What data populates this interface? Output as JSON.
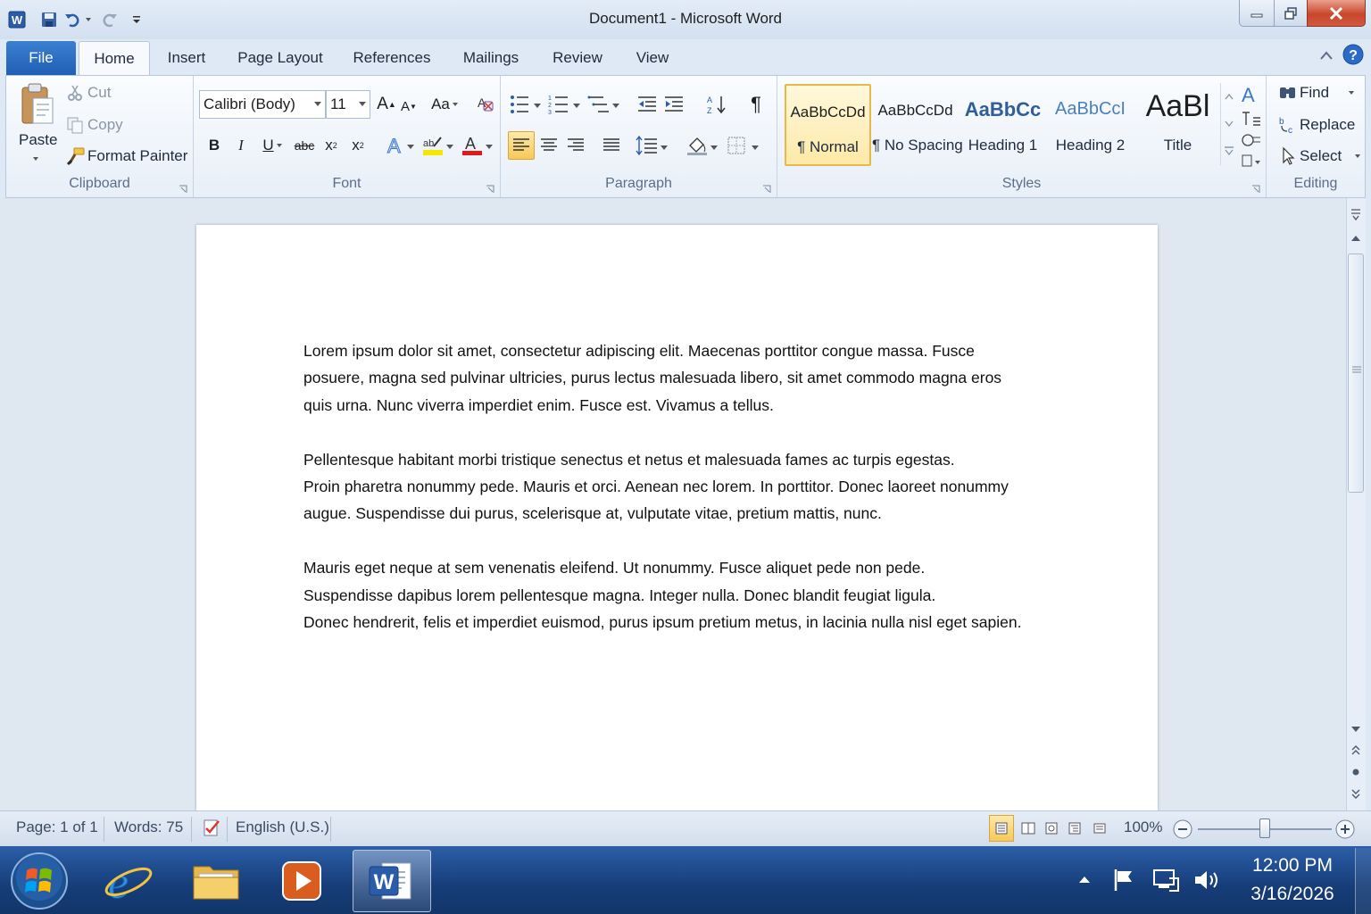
{
  "window": {
    "title": "Document1  -  Microsoft Word",
    "colors": {
      "accent": "#1f5fb4",
      "close": "#c9462c",
      "selected_style": "#fde9a8"
    }
  },
  "tabs": {
    "file": "File",
    "items": [
      "Home",
      "Insert",
      "Page Layout",
      "References",
      "Mailings",
      "Review",
      "View"
    ]
  },
  "ribbon": {
    "clipboard": {
      "label": "Clipboard",
      "paste": "Paste",
      "cut": "Cut",
      "copy": "Copy",
      "format_painter": "Format Painter"
    },
    "font": {
      "label": "Font",
      "font_name": "Calibri (Body)",
      "font_size": "11",
      "grow_glyph": "A",
      "change_case_glyph": "Aa",
      "bold_glyph": "B",
      "italic_glyph": "I",
      "underline_glyph": "U",
      "strike_glyph": "abc",
      "subscript_glyph": "x",
      "superscript_glyph": "x"
    },
    "paragraph": {
      "label": "Paragraph",
      "pilcrow_glyph": "¶"
    },
    "styles": {
      "label": "Styles",
      "items": [
        {
          "sample": "AaBbCcDd",
          "name": "¶ Normal",
          "selected": true
        },
        {
          "sample": "AaBbCcDd",
          "name": "¶ No Spacing",
          "selected": false
        },
        {
          "sample": "AaBbCc",
          "name": "Heading 1",
          "selected": false
        },
        {
          "sample": "AaBbCcI",
          "name": "Heading 2",
          "selected": false
        },
        {
          "sample": "AaBl",
          "name": "Title",
          "selected": false
        }
      ],
      "change_styles_glyph": "A"
    },
    "editing": {
      "label": "Editing",
      "find": "Find",
      "replace": "Replace",
      "select": "Select"
    }
  },
  "document": {
    "paragraphs": [
      [
        "Lorem ipsum dolor sit amet, consectetur adipiscing elit. Maecenas porttitor congue massa. Fusce",
        "posuere, magna sed pulvinar ultricies, purus lectus malesuada libero, sit amet commodo magna eros",
        "quis urna. Nunc viverra imperdiet enim. Fusce est. Vivamus a tellus."
      ],
      [
        "Pellentesque habitant morbi tristique senectus et netus et malesuada fames ac turpis egestas.",
        "Proin pharetra nonummy pede. Mauris et orci. Aenean nec lorem. In porttitor. Donec laoreet nonummy",
        "augue. Suspendisse dui purus, scelerisque at, vulputate vitae, pretium mattis, nunc."
      ],
      [
        "Mauris eget neque at sem venenatis eleifend. Ut nonummy. Fusce aliquet pede non pede.",
        "Suspendisse dapibus lorem pellentesque magna. Integer nulla. Donec blandit feugiat ligula.",
        "Donec hendrerit, felis et imperdiet euismod, purus ipsum pretium metus, in lacinia nulla nisl eget sapien."
      ]
    ]
  },
  "status": {
    "page": "Page: 1 of 1",
    "words": "Words: 75",
    "language": "English (U.S.)",
    "zoom": "100%",
    "zoom_fraction": 0.5
  },
  "taskbar": {
    "time": "12:00 PM",
    "date": "3/16/2026"
  }
}
